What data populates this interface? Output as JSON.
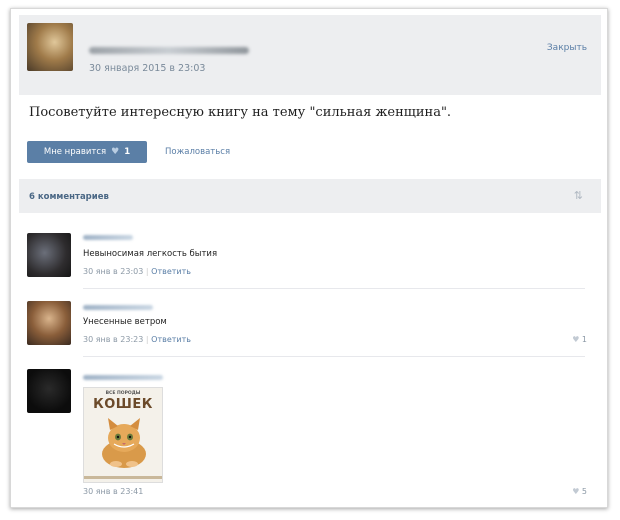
{
  "post": {
    "date": "30 января 2015 в 23:03",
    "close_label": "Закрыть",
    "text": "Посоветуйте интересную книгу на тему \"сильная женщина\".",
    "like_label": "Мне нравится",
    "like_count": "1",
    "report_label": "Пожаловаться"
  },
  "comments_header": {
    "title": "6 комментариев",
    "sort_icon": "sort-icon"
  },
  "comments": [
    {
      "text": "Невыносимая легкость бытия",
      "date": "30 янв в 23:03",
      "reply": "Ответить",
      "likes": ""
    },
    {
      "text": "Унесенные ветром",
      "date": "30 янв в 23:23",
      "reply": "Ответить",
      "likes": "1"
    },
    {
      "text": "",
      "date": "30 янв в 23:41",
      "reply": "",
      "likes": "5",
      "attachment": {
        "subtitle": "ВСЕ ПОРОДЫ",
        "title": "КОШЕК"
      }
    }
  ]
}
